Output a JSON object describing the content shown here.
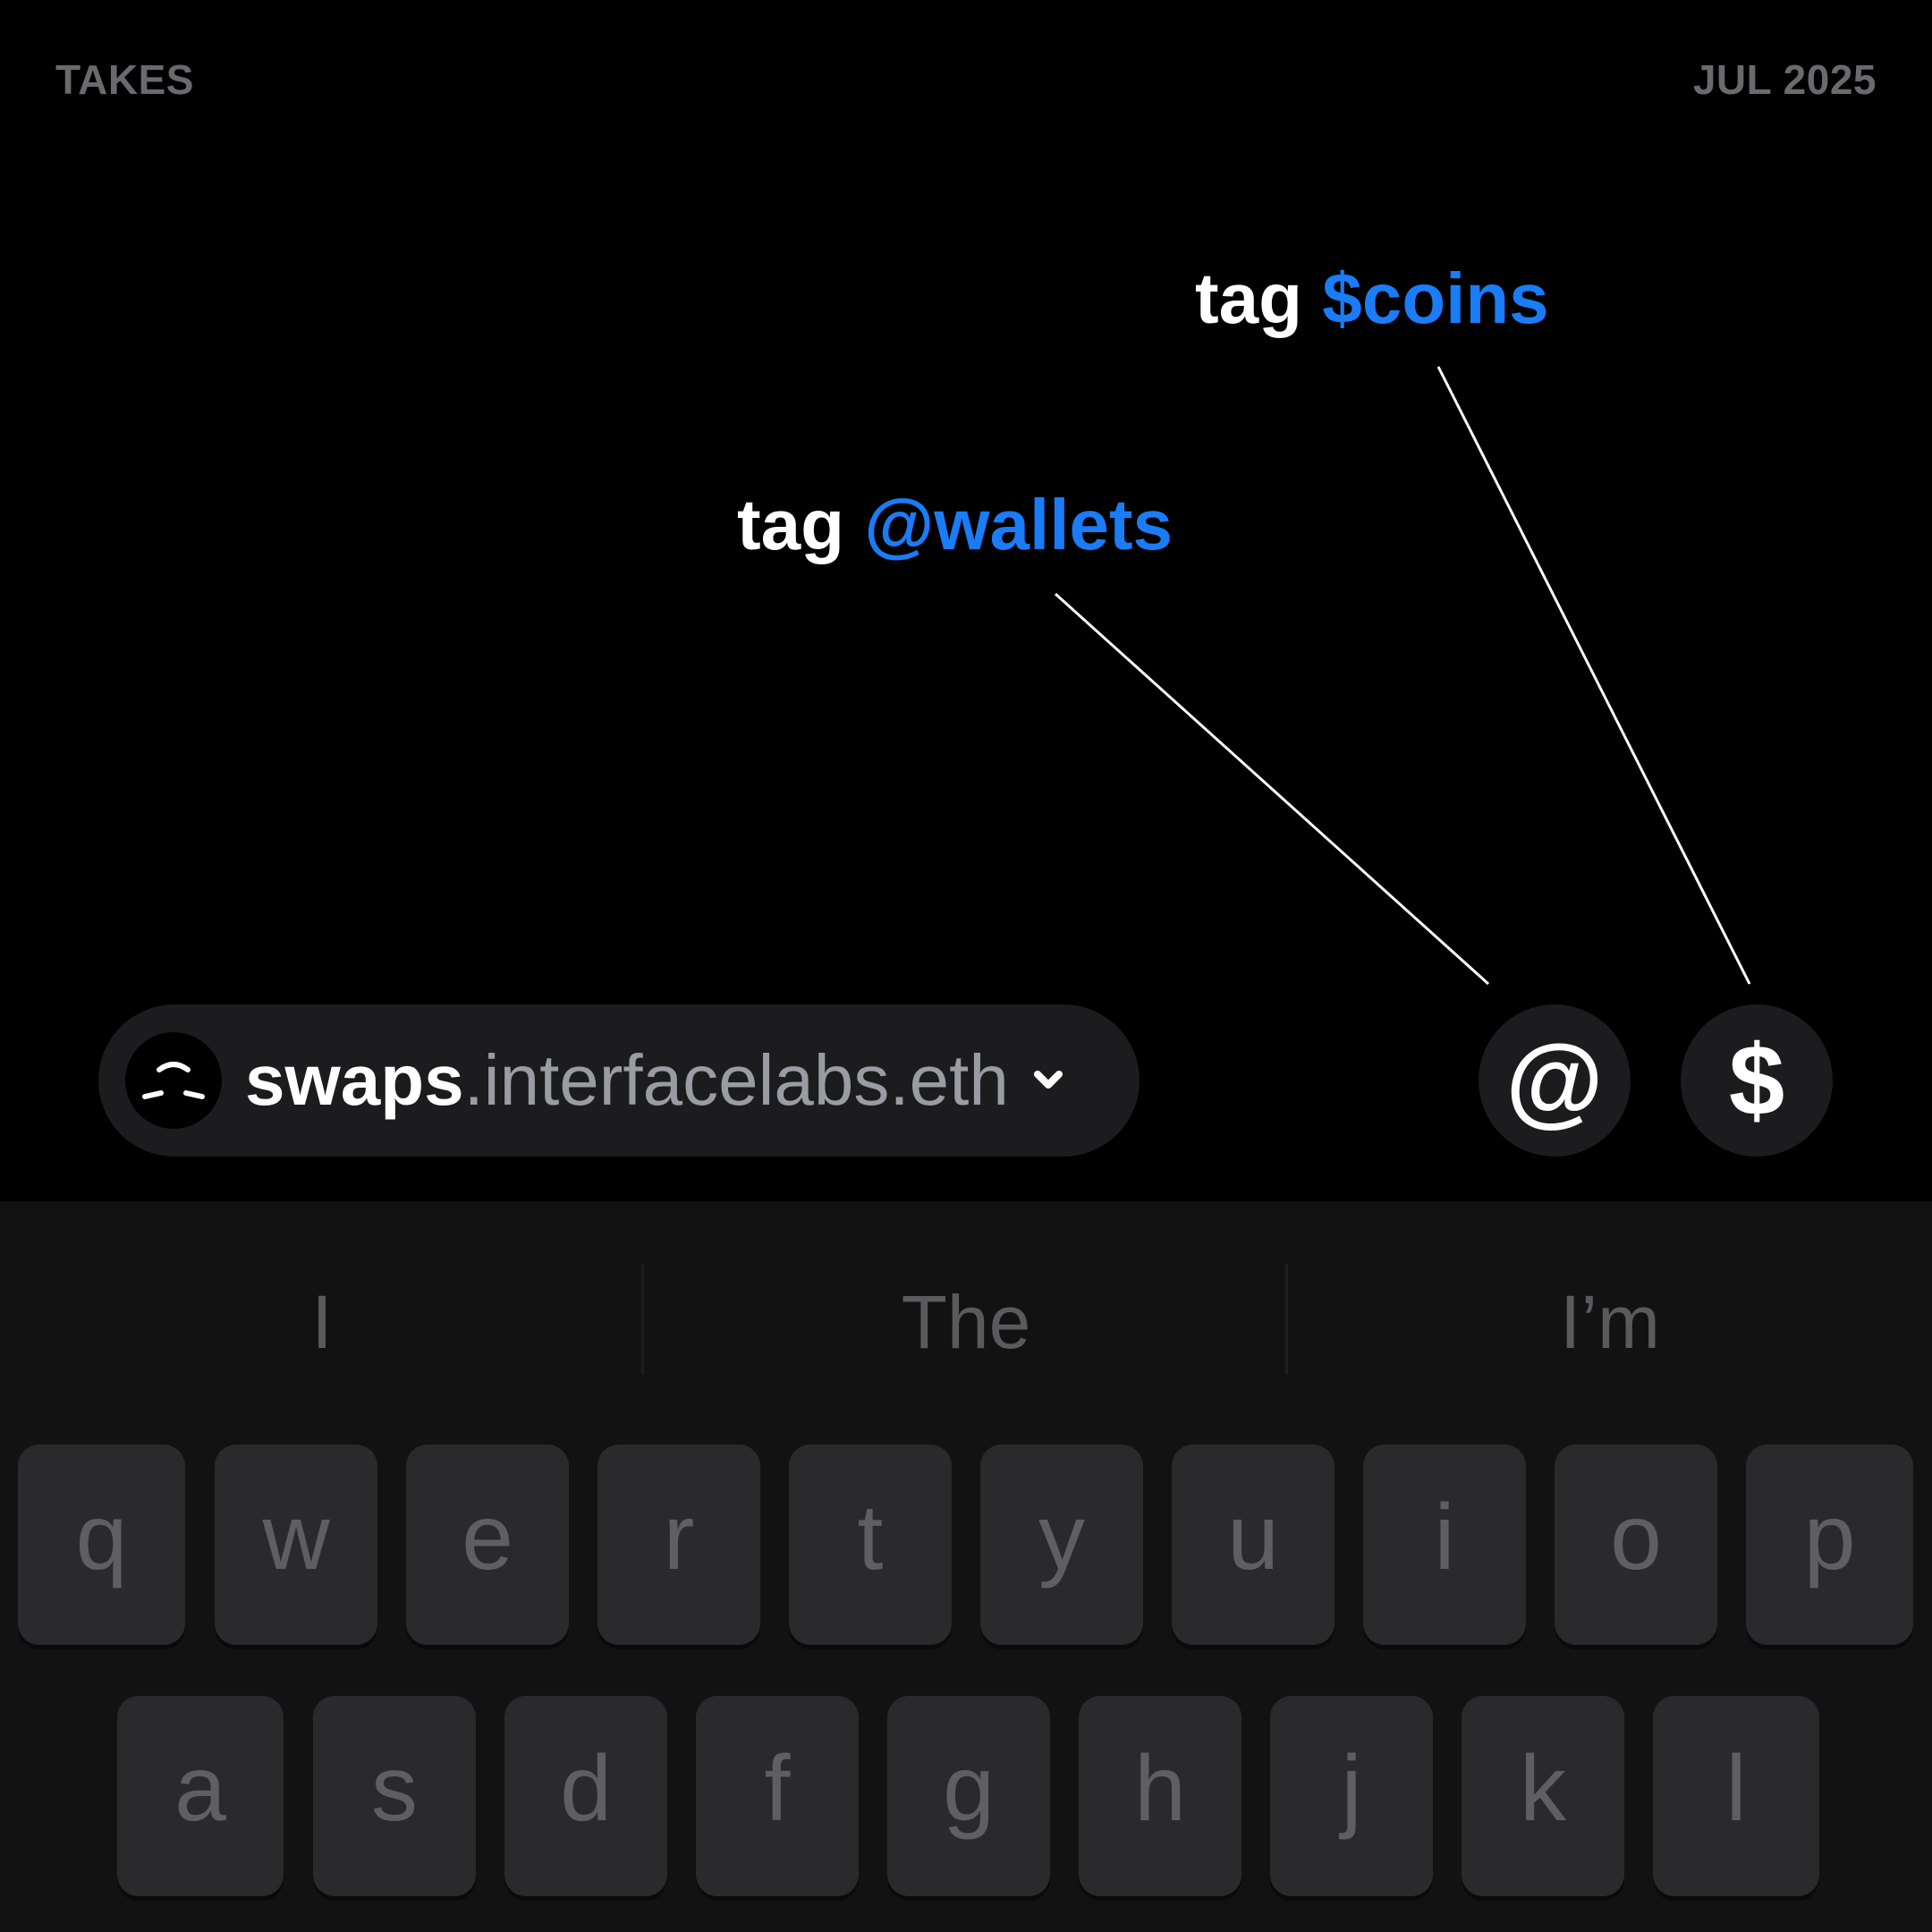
{
  "header": {
    "brand": "TAKES",
    "date": "JUL 2025"
  },
  "annotations": {
    "coins": {
      "prefix": "tag ",
      "highlight": "$coins"
    },
    "wallets": {
      "prefix": "tag ",
      "highlight": "@wallets"
    }
  },
  "account_selector": {
    "name": "swaps",
    "domain": ".interfacelabs.eth",
    "avatar_icon": "smile-face-icon",
    "dropdown_icon": "chevron-down-icon"
  },
  "buttons": {
    "mention": {
      "glyph": "@"
    },
    "coin": {
      "glyph": "$"
    }
  },
  "keyboard": {
    "suggestions": [
      "I",
      "The",
      "I’m"
    ],
    "row1": [
      "q",
      "w",
      "e",
      "r",
      "t",
      "y",
      "u",
      "i",
      "o",
      "p"
    ],
    "row2": [
      "a",
      "s",
      "d",
      "f",
      "g",
      "h",
      "j",
      "k",
      "l"
    ]
  },
  "colors": {
    "accent": "#1a7cf6",
    "background": "#000000",
    "surface": "#1c1c1e",
    "keyboard_bg": "#121212",
    "key_bg": "#2a2a2c"
  }
}
